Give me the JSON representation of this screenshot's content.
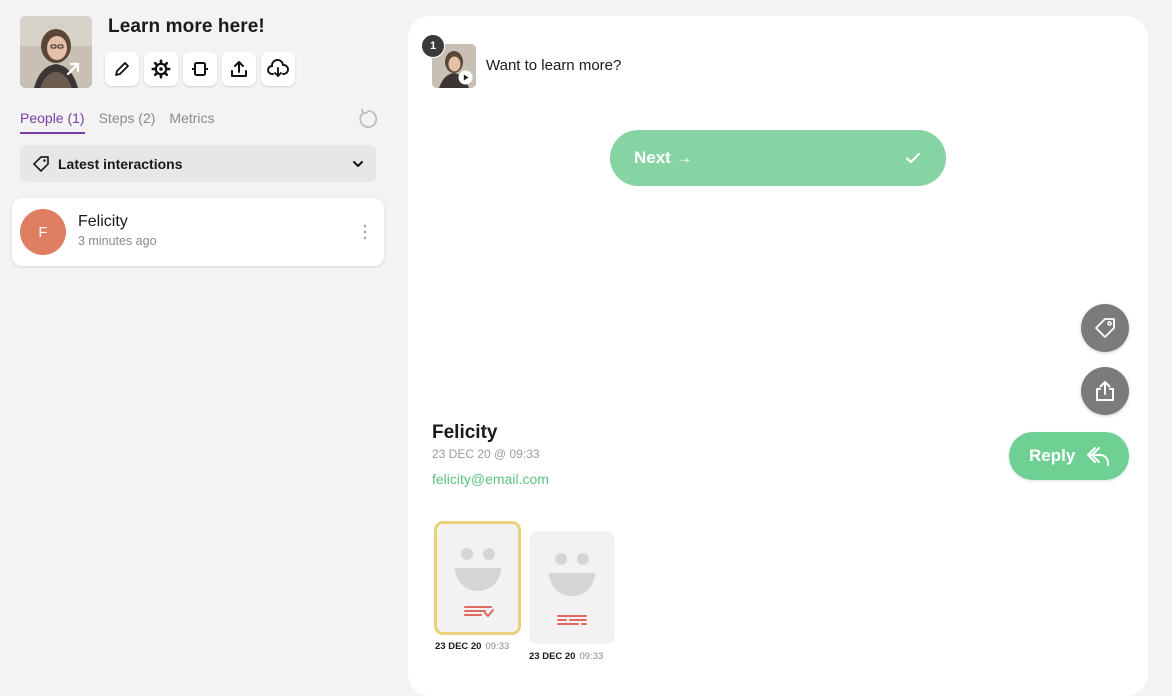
{
  "header": {
    "title": "Learn more here!",
    "toolbar": [
      "edit-icon",
      "settings-icon",
      "embed-icon",
      "share-icon",
      "download-icon"
    ]
  },
  "tabs": [
    {
      "label": "People (1)",
      "active": true
    },
    {
      "label": "Steps (2)",
      "active": false
    },
    {
      "label": "Metrics",
      "active": false
    }
  ],
  "filter": {
    "label": "Latest interactions"
  },
  "people": [
    {
      "initial": "F",
      "name": "Felicity",
      "time": "3 minutes ago",
      "avatar_color": "#e07e63"
    }
  ],
  "step": {
    "number": "1",
    "question": "Want to learn more?",
    "answer_label": "Next →"
  },
  "response": {
    "name": "Felicity",
    "date": "23 DEC 20 @ 09:33",
    "email": "felicity@email.com",
    "reply_label": "Reply"
  },
  "interactions": [
    {
      "date": "23 DEC 20",
      "time": "09:33",
      "selected": true
    },
    {
      "date": "23 DEC 20",
      "time": "09:33",
      "selected": false
    }
  ],
  "colors": {
    "accent": "#7a3ea8",
    "next_button": "#86d4a4",
    "reply_button": "#6fd094",
    "email": "#5cc383",
    "avatar": "#e07e63",
    "selected_border": "#ead07a"
  }
}
